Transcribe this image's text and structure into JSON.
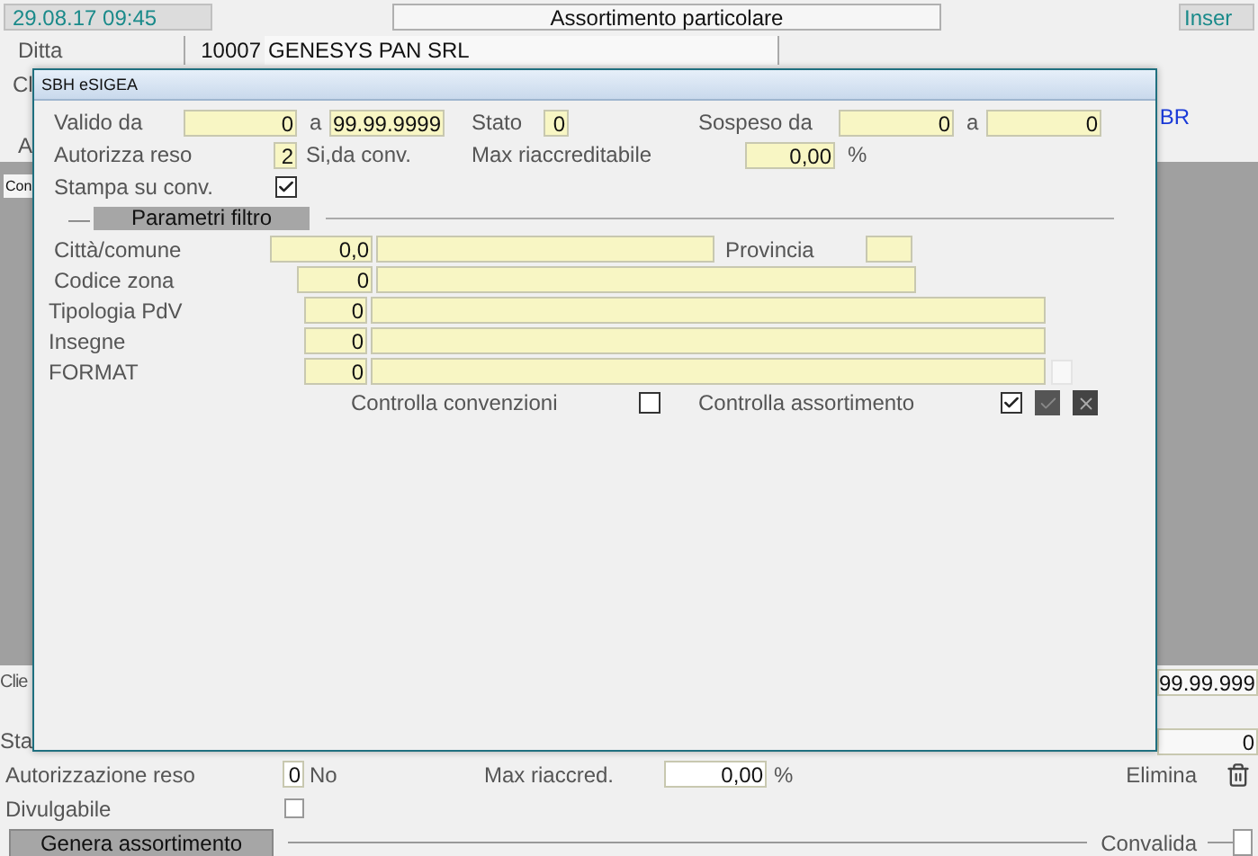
{
  "header": {
    "datetime": "29.08.17 09:45",
    "title": "Assortimento particolare",
    "mode": "Inser"
  },
  "ditta": {
    "label": "Ditta",
    "code": "10007",
    "name": "GENESYS PAN SRL"
  },
  "background": {
    "label_cl": "Cl",
    "label_a": "A",
    "link_br": "BR",
    "tab": "Con",
    "label_clie": "Clie",
    "valid_to": "99.99.999",
    "label_sta": "Sta",
    "stato": "0"
  },
  "dialog": {
    "title": "SBH eSIGEA",
    "valido_da": {
      "label": "Valido da",
      "value": "0",
      "sep": "a",
      "to": "99.99.9999"
    },
    "stato": {
      "label": "Stato",
      "value": "0"
    },
    "sospeso": {
      "label": "Sospeso da",
      "from": "0",
      "sep": "a",
      "to": "0"
    },
    "autorizza": {
      "label": "Autorizza reso",
      "value": "2",
      "desc": "Si,da conv."
    },
    "max": {
      "label": "Max riaccreditabile",
      "value": "0,00",
      "unit": "%"
    },
    "stampa": {
      "label": "Stampa su conv.",
      "checked": true
    },
    "section": {
      "dash": "—",
      "title": "Parametri filtro"
    },
    "filters": [
      {
        "label": "Città/comune",
        "code": "0,0",
        "extra_label": "Provincia"
      },
      {
        "label": "Codice zona",
        "code": "0"
      },
      {
        "label": "Tipologia PdV",
        "code": "0"
      },
      {
        "label": "Insegne",
        "code": "0"
      },
      {
        "label": "FORMAT",
        "code": "0"
      }
    ],
    "controlla_convenzioni": {
      "label": "Controlla convenzioni",
      "checked": false
    },
    "controlla_assortimento": {
      "label": "Controlla assortimento",
      "checked": true
    }
  },
  "footer": {
    "autorizzazione": {
      "label": "Autorizzazione reso",
      "value": "0",
      "desc": "No"
    },
    "max": {
      "label": "Max riaccred.",
      "value": "0,00",
      "unit": "%"
    },
    "elimina": "Elimina",
    "divulgabile": {
      "label": "Divulgabile",
      "checked": false
    },
    "genera": "Genera assortimento",
    "convalida": {
      "label": "Convalida",
      "checked": false
    }
  }
}
